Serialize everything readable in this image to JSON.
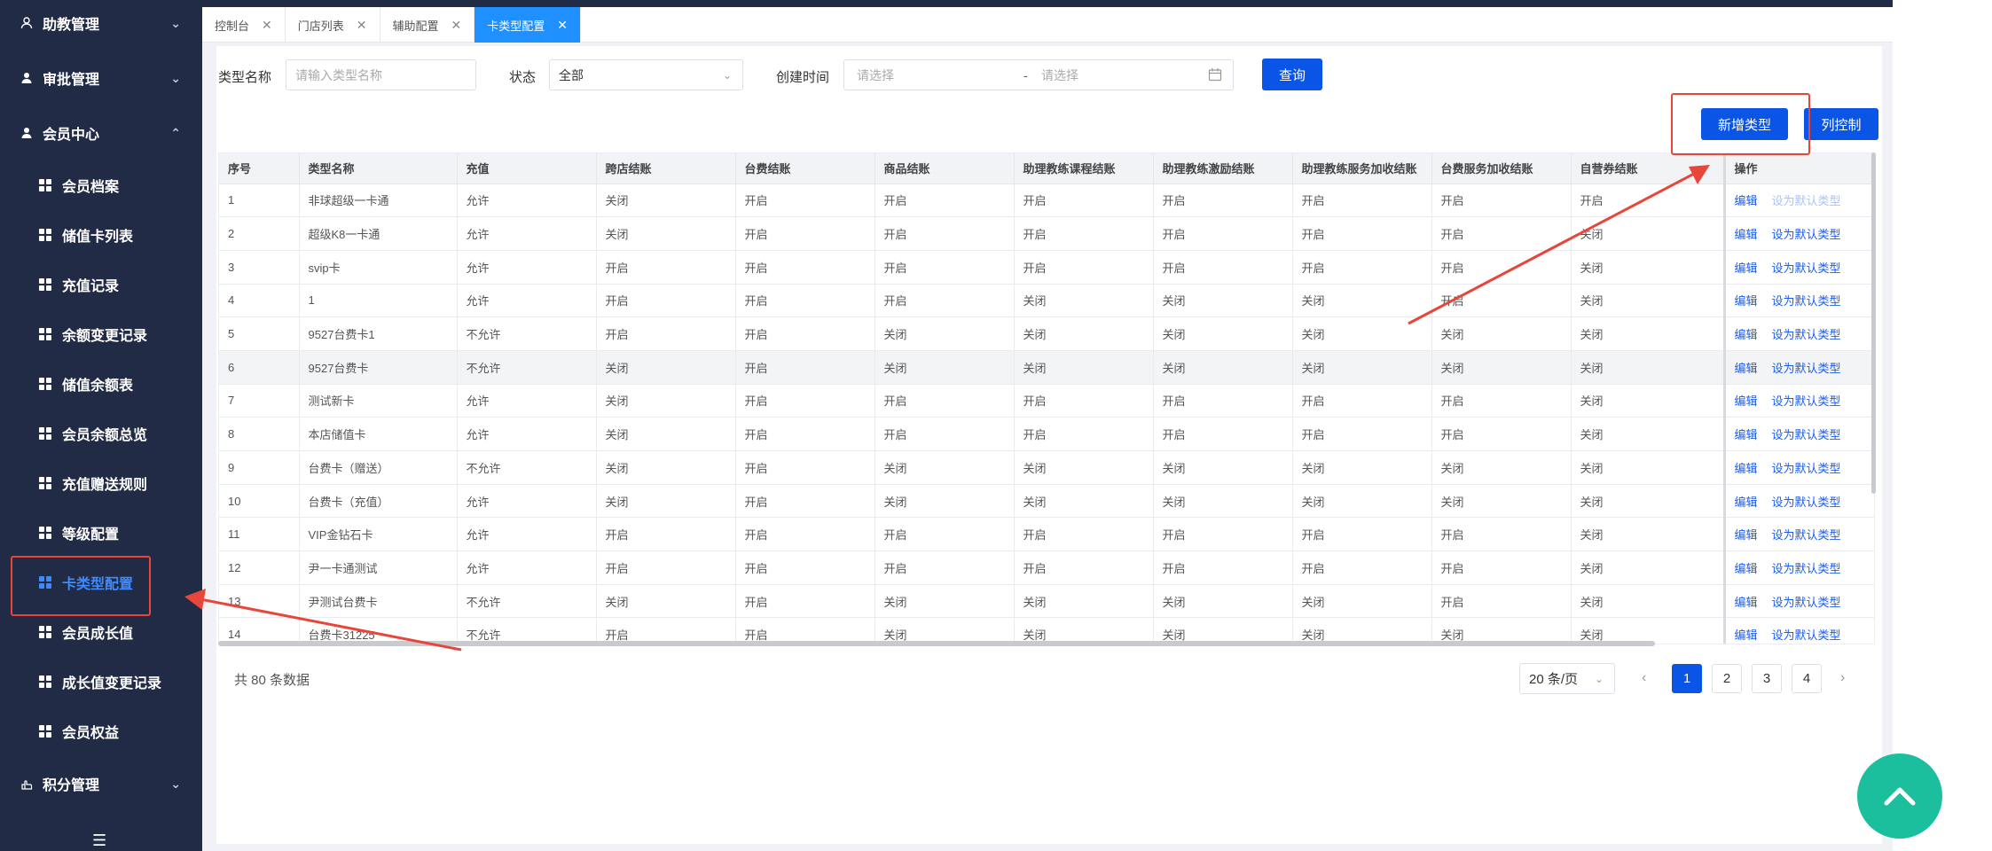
{
  "sidebar": {
    "groups": [
      {
        "label": "助教管理",
        "icon": "user-icon"
      },
      {
        "label": "审批管理",
        "icon": "user-check-icon"
      },
      {
        "label": "会员中心",
        "icon": "member-icon"
      }
    ],
    "items": [
      {
        "label": "会员档案"
      },
      {
        "label": "储值卡列表"
      },
      {
        "label": "充值记录"
      },
      {
        "label": "余额变更记录"
      },
      {
        "label": "储值余额表"
      },
      {
        "label": "会员余额总览"
      },
      {
        "label": "充值赠送规则"
      },
      {
        "label": "等级配置"
      },
      {
        "label": "卡类型配置"
      },
      {
        "label": "会员成长值"
      },
      {
        "label": "成长值变更记录"
      },
      {
        "label": "会员权益"
      }
    ],
    "bottom_group": {
      "label": "积分管理"
    }
  },
  "tabs": [
    {
      "label": "控制台"
    },
    {
      "label": "门店列表"
    },
    {
      "label": "辅助配置"
    },
    {
      "label": "卡类型配置"
    }
  ],
  "filters": {
    "type_name_label": "类型名称",
    "type_name_placeholder": "请输入类型名称",
    "status_label": "状态",
    "status_value": "全部",
    "created_label": "创建时间",
    "date_start_placeholder": "请选择",
    "date_sep": "-",
    "date_end_placeholder": "请选择",
    "query_button": "查询"
  },
  "actions": {
    "add_type": "新增类型",
    "column_control": "列控制"
  },
  "table": {
    "columns": [
      "序号",
      "类型名称",
      "充值",
      "跨店结账",
      "台费结账",
      "商品结账",
      "助理教练课程结账",
      "助理教练激励结账",
      "助理教练服务加收结账",
      "台费服务加收结账",
      "自营券结账",
      "操作"
    ],
    "edit_label": "编辑",
    "set_default_label": "设为默认类型",
    "rows": [
      [
        "1",
        "非球超级一卡通",
        "允许",
        "关闭",
        "开启",
        "开启",
        "开启",
        "开启",
        "开启",
        "开启",
        "开启"
      ],
      [
        "2",
        "超级K8一卡通",
        "允许",
        "关闭",
        "开启",
        "开启",
        "开启",
        "开启",
        "开启",
        "开启",
        "关闭"
      ],
      [
        "3",
        "svip卡",
        "允许",
        "开启",
        "开启",
        "开启",
        "开启",
        "开启",
        "开启",
        "开启",
        "关闭"
      ],
      [
        "4",
        "1",
        "允许",
        "开启",
        "开启",
        "开启",
        "关闭",
        "关闭",
        "关闭",
        "开启",
        "关闭"
      ],
      [
        "5",
        "9527台费卡1",
        "不允许",
        "开启",
        "开启",
        "关闭",
        "关闭",
        "关闭",
        "关闭",
        "关闭",
        "关闭"
      ],
      [
        "6",
        "9527台费卡",
        "不允许",
        "关闭",
        "开启",
        "关闭",
        "关闭",
        "关闭",
        "关闭",
        "关闭",
        "关闭"
      ],
      [
        "7",
        "测试新卡",
        "允许",
        "关闭",
        "开启",
        "开启",
        "开启",
        "开启",
        "开启",
        "开启",
        "关闭"
      ],
      [
        "8",
        "本店储值卡",
        "允许",
        "关闭",
        "开启",
        "开启",
        "开启",
        "开启",
        "开启",
        "开启",
        "关闭"
      ],
      [
        "9",
        "台费卡（赠送）",
        "不允许",
        "关闭",
        "开启",
        "关闭",
        "关闭",
        "关闭",
        "关闭",
        "关闭",
        "关闭"
      ],
      [
        "10",
        "台费卡（充值）",
        "允许",
        "关闭",
        "开启",
        "关闭",
        "关闭",
        "关闭",
        "关闭",
        "关闭",
        "关闭"
      ],
      [
        "11",
        "VIP金钻石卡",
        "允许",
        "开启",
        "开启",
        "开启",
        "开启",
        "开启",
        "开启",
        "开启",
        "关闭"
      ],
      [
        "12",
        "尹一卡通测试",
        "允许",
        "开启",
        "开启",
        "开启",
        "开启",
        "开启",
        "开启",
        "开启",
        "关闭"
      ],
      [
        "13",
        "尹测试台费卡",
        "不允许",
        "关闭",
        "开启",
        "关闭",
        "关闭",
        "关闭",
        "关闭",
        "开启",
        "关闭"
      ],
      [
        "14",
        "台费卡31225",
        "不允许",
        "开启",
        "开启",
        "关闭",
        "关闭",
        "关闭",
        "关闭",
        "关闭",
        "关闭"
      ]
    ]
  },
  "footer": {
    "total_text": "共 80 条数据",
    "page_size": "20 条/页",
    "pages": [
      "1",
      "2",
      "3",
      "4"
    ],
    "current_page": 1
  },
  "colors": {
    "sidebar_bg": "#222b45",
    "primary": "#0a55e5",
    "annotation_red": "#e8463b",
    "fab": "#1bbf9e"
  }
}
